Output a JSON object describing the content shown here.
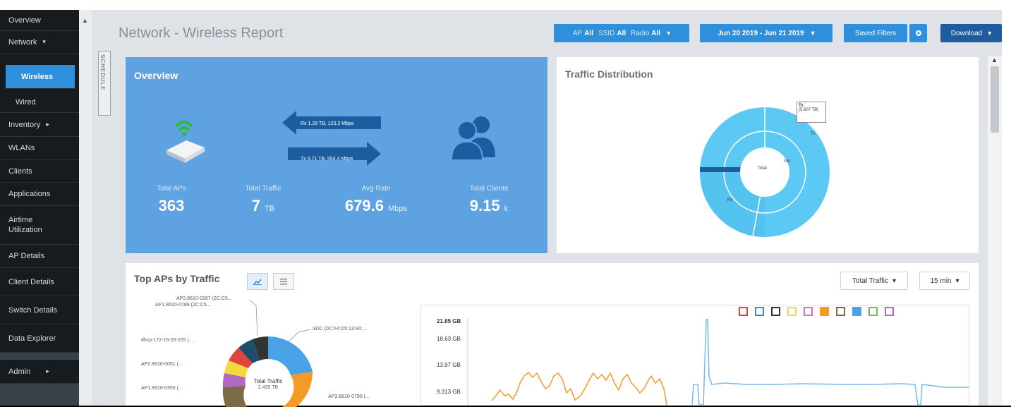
{
  "sidebar": {
    "items": [
      {
        "label": "Overview",
        "caret": ""
      },
      {
        "label": "Network",
        "caret": "▾"
      },
      {
        "label": "Wireless",
        "caret": ""
      },
      {
        "label": "Wired",
        "caret": ""
      },
      {
        "label": "Inventory",
        "caret": "▸"
      },
      {
        "label": "WLANs",
        "caret": ""
      },
      {
        "label": "Clients",
        "caret": ""
      },
      {
        "label": "Applications",
        "caret": ""
      },
      {
        "label": "Airtime Utilization",
        "caret": ""
      },
      {
        "label": "AP Details",
        "caret": ""
      },
      {
        "label": "Client Details",
        "caret": ""
      },
      {
        "label": "Switch Details",
        "caret": ""
      },
      {
        "label": "Data Explorer",
        "caret": ""
      },
      {
        "label": "Admin",
        "caret": "▸"
      }
    ],
    "active": "Wireless"
  },
  "header": {
    "title": "Network - Wireless Report",
    "schedule_tab": "SCHEDULE",
    "filter": {
      "ap_label": "AP",
      "ap_value": "All",
      "ssid_label": "SSID",
      "ssid_value": "All",
      "radio_label": "Radio",
      "radio_value": "All",
      "caret": "▾"
    },
    "date_range": "Jun 20 2019 - Jun 21 2019",
    "saved_filters": "Saved Filters",
    "settings_icon": "gear-icon",
    "download": "Download"
  },
  "overview": {
    "title": "Overview",
    "rx_label": "Rx 1.29 TB, 125.2 Mbps",
    "tx_label": "Tx 5.71 TB, 554.4 Mbps",
    "stats": [
      {
        "label": "Total APs",
        "value": "363",
        "unit": ""
      },
      {
        "label": "Total Traffic",
        "value": "7",
        "unit": "TB"
      },
      {
        "label": "Avg Rate",
        "value": "679.6",
        "unit": "Mbps"
      },
      {
        "label": "Total Clients",
        "value": "9.15",
        "unit": "k"
      }
    ],
    "colors": {
      "panel": "#5ea2e2",
      "arrow": "#1d5c9e"
    }
  },
  "traffic_distribution": {
    "title": "Traffic Distribution",
    "center_label": "Total",
    "labels": {
      "tx": "Tx",
      "rx": "Rx",
      "usr": "Usr"
    },
    "tooltip": {
      "title": "Tx",
      "value": "(5.607 TB)"
    }
  },
  "top_aps": {
    "title": "Top APs by Traffic",
    "view_chart_icon": "line-chart-icon",
    "view_table_icon": "list-icon",
    "metric_select": "Total Traffic",
    "interval_select": "15 min",
    "donut_center": {
      "title": "Total Traffic",
      "value": "2.435 TB"
    },
    "donut_labels": [
      "AP2.8610-0287 (2C:C5...",
      "AP1.8610-0789 (2C:C5...",
      "dhcp-172-16-20-225 (...",
      "AP2.8610-0051 (...",
      "AP1.8610-0355 (...",
      "SDC (0C:F4:D5:13:34:...",
      "AP3.8610-0790 (..."
    ],
    "y_ticks": [
      "21.85 GB",
      "18.63 GB",
      "13.97 GB",
      "9.313 GB"
    ],
    "legend_colors": [
      "#e0453d",
      "#2e8fdc",
      "#333333",
      "#f3d93b",
      "#e26bbd",
      "#f59a27",
      "#7a6a45",
      "#4aa3e6",
      "#6cc24a",
      "#b068c2"
    ]
  }
}
